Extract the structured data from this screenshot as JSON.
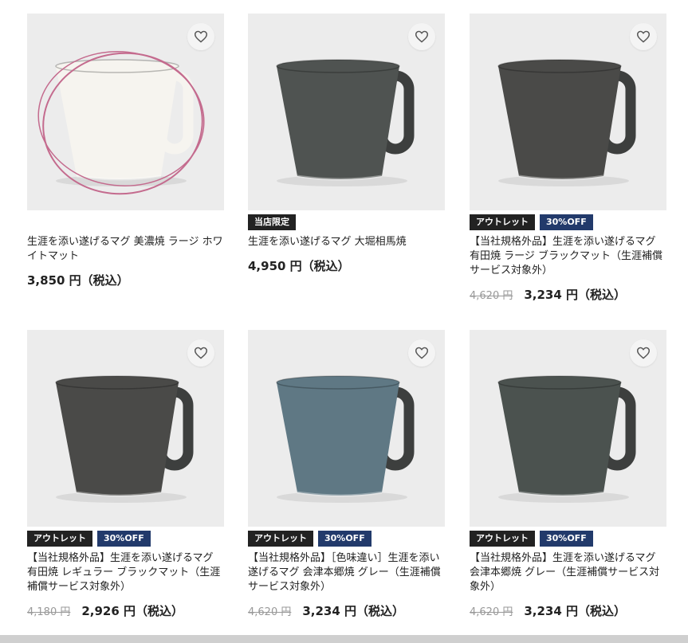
{
  "products": [
    {
      "name": "生涯を添い遂げるマグ 美濃焼 ラージ ホワイトマット",
      "tags": [],
      "old_price": "",
      "price": "3,850 円（税込）",
      "favorite_icon": "heart-icon",
      "mug_color": "#f6f4ef",
      "circled": true
    },
    {
      "name": "生涯を添い遂げるマグ 大堀相馬焼",
      "tags": [
        {
          "label": "当店限定",
          "style": "dark"
        }
      ],
      "old_price": "",
      "price": "4,950 円（税込）",
      "favorite_icon": "heart-icon",
      "mug_color": "#4f5351"
    },
    {
      "name": "【当社規格外品】生涯を添い遂げるマグ 有田焼 ラージ ブラックマット（生涯補償サービス対象外）",
      "tags": [
        {
          "label": "アウトレット",
          "style": "dark"
        },
        {
          "label": "30%OFF",
          "style": "navy"
        }
      ],
      "old_price": "4,620 円",
      "price": "3,234 円（税込）",
      "favorite_icon": "heart-icon",
      "mug_color": "#4a4a48"
    },
    {
      "name": "【当社規格外品】生涯を添い遂げるマグ 有田焼 レギュラー ブラックマット（生涯補償サービス対象外）",
      "tags": [
        {
          "label": "アウトレット",
          "style": "dark"
        },
        {
          "label": "30%OFF",
          "style": "navy"
        }
      ],
      "old_price": "4,180 円",
      "price": "2,926 円（税込）",
      "favorite_icon": "heart-icon",
      "mug_color": "#4a4a48"
    },
    {
      "name": "【当社規格外品】［色味違い］生涯を添い遂げるマグ 会津本郷焼 グレー（生涯補償サービス対象外）",
      "tags": [
        {
          "label": "アウトレット",
          "style": "dark"
        },
        {
          "label": "30%OFF",
          "style": "navy"
        }
      ],
      "old_price": "4,620 円",
      "price": "3,234 円（税込）",
      "favorite_icon": "heart-icon",
      "mug_color": "#5f7884"
    },
    {
      "name": "【当社規格外品】生涯を添い遂げるマグ 会津本郷焼 グレー（生涯補償サービス対象外）",
      "tags": [
        {
          "label": "アウトレット",
          "style": "dark"
        },
        {
          "label": "30%OFF",
          "style": "navy"
        }
      ],
      "old_price": "4,620 円",
      "price": "3,234 円（税込）",
      "favorite_icon": "heart-icon",
      "mug_color": "#4b524f"
    }
  ]
}
